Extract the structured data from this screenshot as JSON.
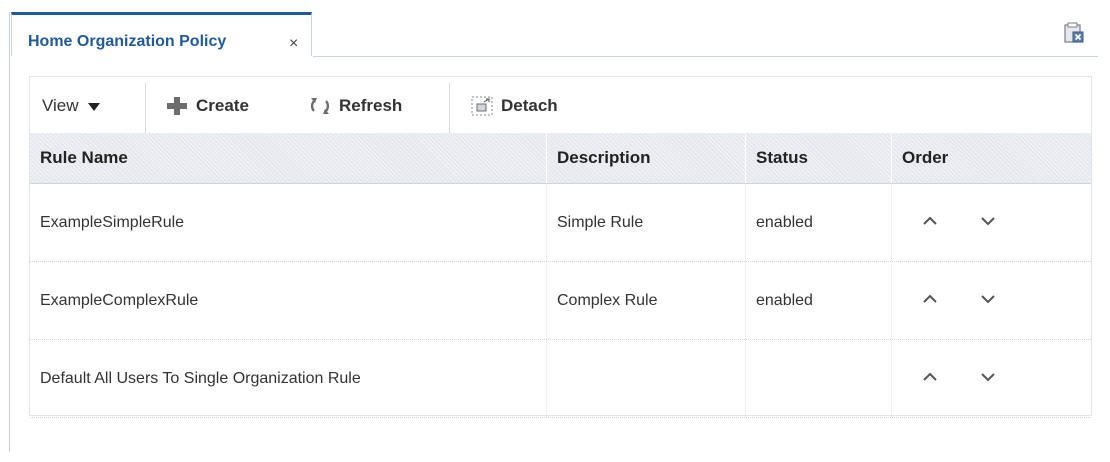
{
  "tab": {
    "title": "Home Organization Policy",
    "close_glyph": "×"
  },
  "toolbar": {
    "view_label": "View",
    "create_label": "Create",
    "refresh_label": "Refresh",
    "detach_label": "Detach"
  },
  "table": {
    "columns": [
      "Rule Name",
      "Description",
      "Status",
      "Order"
    ],
    "rows": [
      {
        "rule_name": "ExampleSimpleRule",
        "description": "Simple Rule",
        "status": "enabled"
      },
      {
        "rule_name": "ExampleComplexRule",
        "description": "Complex Rule",
        "status": "enabled"
      },
      {
        "rule_name": "Default All Users To Single Organization Rule",
        "description": "",
        "status": ""
      }
    ]
  },
  "icons": {
    "create": "plus-icon",
    "refresh": "refresh-icon",
    "detach": "detach-icon",
    "view": "chevron-down-icon",
    "order_up": "chevron-up-icon",
    "order_down": "chevron-down-icon",
    "window": "detach-window-icon"
  },
  "colors": {
    "tab_accent": "#1f5b9c",
    "header_bg": "#e5e9ee",
    "icon_gray": "#6d6d6d"
  }
}
